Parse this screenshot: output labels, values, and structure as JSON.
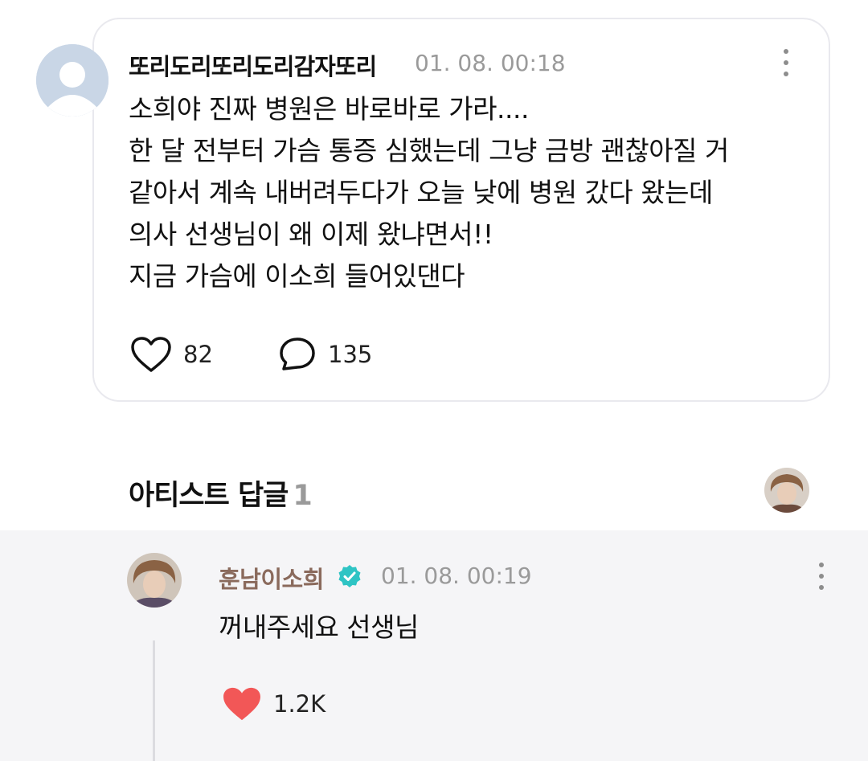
{
  "post": {
    "author": "또리도리또리도리감자또리",
    "time": "01. 08. 00:18",
    "lines": [
      "소희야 진짜 병원은 바로바로 가라....",
      "한 달 전부터 가슴 통증 심했는데 그냥 금방 괜찮아질 거",
      "같아서 계속 내버려두다가 오늘 낮에 병원 갔다 왔는데",
      "의사 선생님이 왜 이제 왔냐면서!!",
      "지금 가슴에 이소희 들어있댄다"
    ],
    "likes": "82",
    "comments": "135"
  },
  "artist_replies": {
    "title": "아티스트 답글",
    "count": "1"
  },
  "reply": {
    "author": "훈남이소희",
    "time": "01. 08. 00:19",
    "text": "꺼내주세요 선생님",
    "likes": "1.2K"
  },
  "colors": {
    "heart_filled": "#f25757",
    "verified": "#2ec4c4",
    "artist_name": "#8a6a5c"
  }
}
